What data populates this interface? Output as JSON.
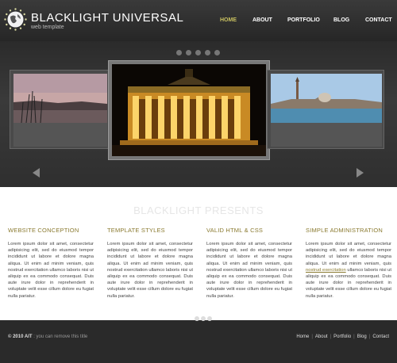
{
  "header": {
    "title": "BLACKLIGHT UNIVERSAL",
    "subtitle": "web template",
    "nav": [
      {
        "label": "HOME",
        "active": true
      },
      {
        "label": "ABOUT",
        "active": false
      },
      {
        "label": "PORTFOLIO",
        "active": false
      },
      {
        "label": "BLOG",
        "active": false
      },
      {
        "label": "CONTACT",
        "active": false
      }
    ]
  },
  "slider": {
    "dot_count": 5
  },
  "content": {
    "presents": "BLACKLIGHT PRESENTS",
    "columns": [
      {
        "title": "WEBSITE CONCEPTION",
        "text": "Lorem ipsum dolor sit amet, consectetur adipisicing elit, sed do eiusmod tempor incididunt ut labore et dolore magna aliqua. Ut enim ad minim veniam, quis nostrud exercitation ullamco laboris nisi ut aliquip ex ea commodo consequat. Duis aute irure dolor in reprehenderit in voluptate velit esse cillum dolore eu fugiat nulla pariatur."
      },
      {
        "title": "TEMPLATE STYLES",
        "text": "Lorem ipsum dolor sit amet, consectetur adipisicing elit, sed do eiusmod tempor incididunt ut labore et dolore magna aliqua. Ut enim ad minim veniam, quis nostrud exercitation ullamco laboris nisi ut aliquip ex ea commodo consequat. Duis aute irure dolor in reprehenderit in voluptate velit esse cillum dolore eu fugiat nulla pariatur."
      },
      {
        "title": "VALID HTML & CSS",
        "text": "Lorem ipsum dolor sit amet, consectetur adipisicing elit, sed do eiusmod tempor incididunt ut labore et dolore magna aliqua. Ut enim ad minim veniam, quis nostrud exercitation ullamco laboris nisi ut aliquip ex ea commodo consequat. Duis aute irure dolor in reprehenderit in voluptate velit esse cillum dolore eu fugiat nulla pariatur."
      },
      {
        "title": "SIMPLE ADMINISTRATION",
        "text_before": "Lorem ipsum dolor sit amet, consectetur adipisicing elit, sed do eiusmod tempor incididunt ut labore et dolore magna aliqua. Ut enim ad minim veniam, quis ",
        "link": "nostrud exercitation",
        "text_after": " ullamco laboris nisi ut aliquip ex ea commodo consequat. Duis aute irure dolor in reprehenderit in voluptate velit esse cillum dolore eu fugiat nulla pariatur."
      }
    ]
  },
  "footer": {
    "copyright_strong": "© 2010 AIT",
    "copyright_rest": " : you can remove this title",
    "links": [
      "Home",
      "About",
      "Portfolio",
      "Blog",
      "Contact"
    ]
  },
  "colors": {
    "accent": "#8a7a30",
    "nav_active": "#c8c060",
    "background": "#2a2a2a"
  }
}
